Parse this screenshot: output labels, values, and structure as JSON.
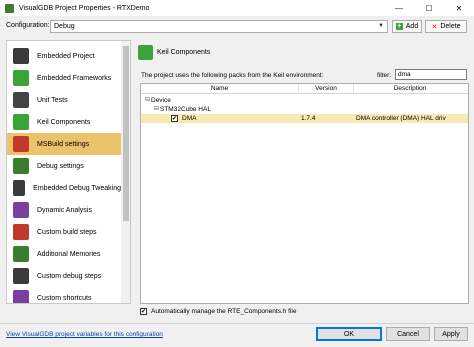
{
  "window": {
    "title": "VisualGDB Project Properties - RTXDemo",
    "controls": {
      "minimize": "—",
      "maximize": "☐",
      "close": "✕"
    }
  },
  "config": {
    "label": "Configuration:",
    "value": "Debug",
    "add_label": "Add",
    "delete_label": "Delete"
  },
  "sidebar": {
    "selected_index": 4,
    "items": [
      {
        "label": "Embedded Project",
        "icon": "embedded-project-icon",
        "color": "#3a3a3a"
      },
      {
        "label": "Embedded Frameworks",
        "icon": "frameworks-icon",
        "color": "#3aa536"
      },
      {
        "label": "Unit Tests",
        "icon": "unit-tests-icon",
        "color": "#444444"
      },
      {
        "label": "Keil Components",
        "icon": "keil-components-icon",
        "color": "#3aa536"
      },
      {
        "label": "MSBuild settings",
        "icon": "msbuild-icon",
        "color": "#c0392b"
      },
      {
        "label": "Debug settings",
        "icon": "debug-settings-icon",
        "color": "#3a7d2c"
      },
      {
        "label": "Embedded Debug Tweaking",
        "icon": "debug-tweaking-icon",
        "color": "#3a3a3a"
      },
      {
        "label": "Dynamic Analysis",
        "icon": "dynamic-analysis-icon",
        "color": "#7b3fa0"
      },
      {
        "label": "Custom build steps",
        "icon": "build-steps-icon",
        "color": "#c0392b"
      },
      {
        "label": "Additional Memories",
        "icon": "memories-icon",
        "color": "#3a7d2c"
      },
      {
        "label": "Custom debug steps",
        "icon": "debug-steps-icon",
        "color": "#3a3a3a"
      },
      {
        "label": "Custom shortcuts",
        "icon": "shortcuts-icon",
        "color": "#7b3fa0"
      }
    ]
  },
  "panel": {
    "title": "Keil Components",
    "info": "The project uses the following packs from the Keil environment:",
    "filter_label": "filter:",
    "filter_value": "dma"
  },
  "tree": {
    "columns": {
      "name": "Name",
      "version": "Version",
      "description": "Description"
    },
    "rows": [
      {
        "toggle": "⊟",
        "name": "Device",
        "version": "",
        "description": ""
      },
      {
        "toggle": "⊟",
        "name": "STM32Cube HAL",
        "version": "",
        "description": ""
      },
      {
        "toggle": "",
        "checked": true,
        "name": "DMA",
        "version": "1.7.4",
        "description": "DMA controller (DMA) HAL driv"
      }
    ]
  },
  "auto_manage": {
    "checked": true,
    "label": "Automatically manage the RTE_Components.h file"
  },
  "footer": {
    "link": "View VisualGDB project variables for this configuration",
    "ok": "OK",
    "cancel": "Cancel",
    "apply": "Apply"
  },
  "colors": {
    "selected_item": "#ebc36a",
    "selected_row": "#f9e9b2",
    "link": "#0645ad",
    "accent_green": "#3aa536"
  }
}
